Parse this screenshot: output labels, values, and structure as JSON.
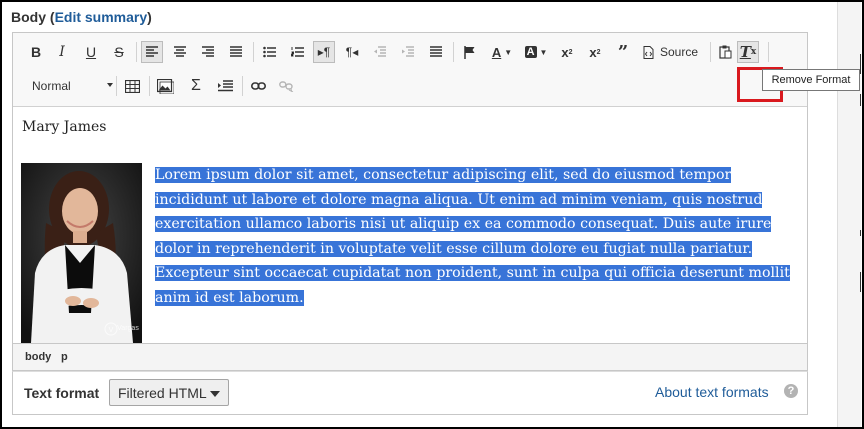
{
  "field": {
    "label": "Body",
    "open_paren": "(",
    "edit_summary_link": "Edit summary",
    "close_paren": ")"
  },
  "toolbar": {
    "source_label": "Source",
    "styles_value": "Normal",
    "tooltip": "Remove Format"
  },
  "content": {
    "author_name": "Mary James",
    "paragraph_lines": [
      "Lorem ipsum dolor sit amet, consectetur adipiscing elit, sed do eiusmod tempor",
      "incididunt ut labore et dolore magna aliqua. Ut enim ad minim veniam, quis nostrud",
      "exercitation ullamco laboris nisi ut aliquip ex ea commodo consequat. Duis aute irure",
      "dolor in reprehenderit in voluptate velit esse cillum dolore eu fugiat nulla pariatur.",
      "Excepteur sint occaecat cupidatat non proident, sunt in culpa qui officia deserunt mollit",
      "anim id est laborum."
    ],
    "photo_watermark": "Vargas"
  },
  "status_path": [
    "body",
    "p"
  ],
  "text_format": {
    "label": "Text format",
    "selected": "Filtered HTML",
    "about_link": "About text formats",
    "help_symbol": "?"
  },
  "colors": {
    "selection": "#3874d8",
    "link": "#1f5c99",
    "highlight_box": "#d9191e"
  }
}
